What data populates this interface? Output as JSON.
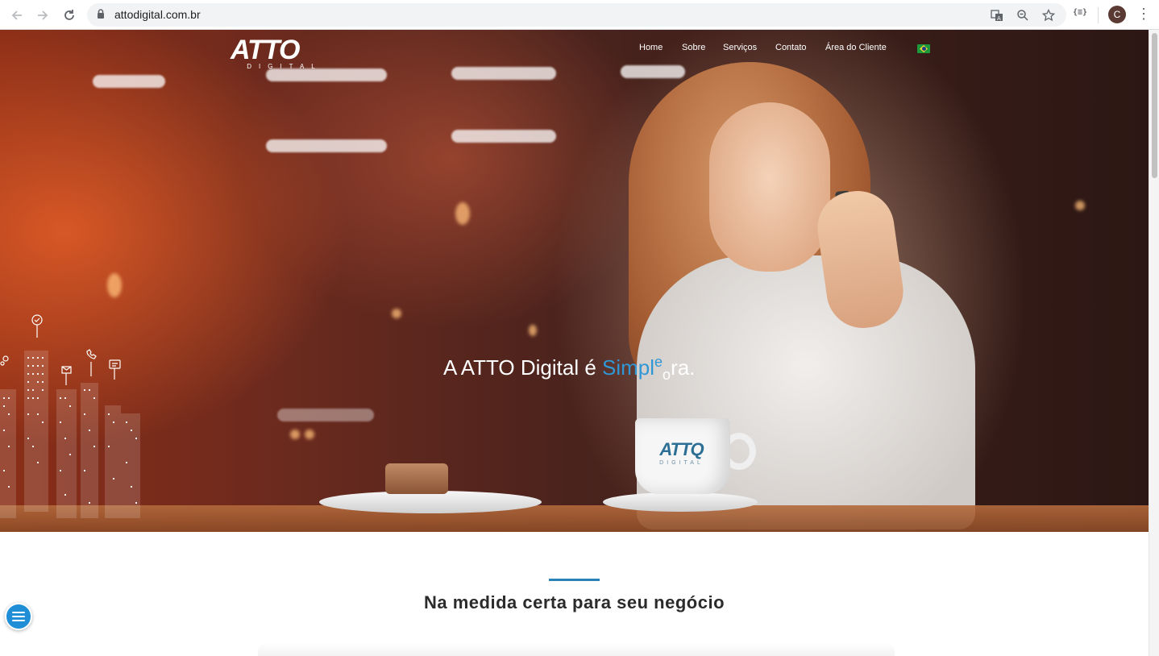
{
  "browser": {
    "url": "attodigital.com.br",
    "avatar_initial": "C",
    "extension_label": "{≡}"
  },
  "site": {
    "logo_text": "ATTO",
    "logo_sub": "DIGITAL",
    "nav": [
      {
        "label": "Home"
      },
      {
        "label": "Sobre"
      },
      {
        "label": "Serviços"
      },
      {
        "label": "Contato"
      },
      {
        "label": "Área do Cliente"
      }
    ],
    "language_flag": "brazil-flag-icon"
  },
  "hero": {
    "headline_prefix": "A ATTO Digital é ",
    "headline_accent": "Simpl",
    "headline_accent_raised": "e",
    "headline_lowered": "o",
    "headline_suffix": "ra.",
    "cup_logo_main": "ATTQ",
    "cup_logo_sub": "DIGITAL"
  },
  "section": {
    "title": "Na medida certa para seu negócio"
  },
  "colors": {
    "accent": "#2f97d6",
    "rule": "#2a83b8",
    "fab": "#1f8ed6"
  }
}
